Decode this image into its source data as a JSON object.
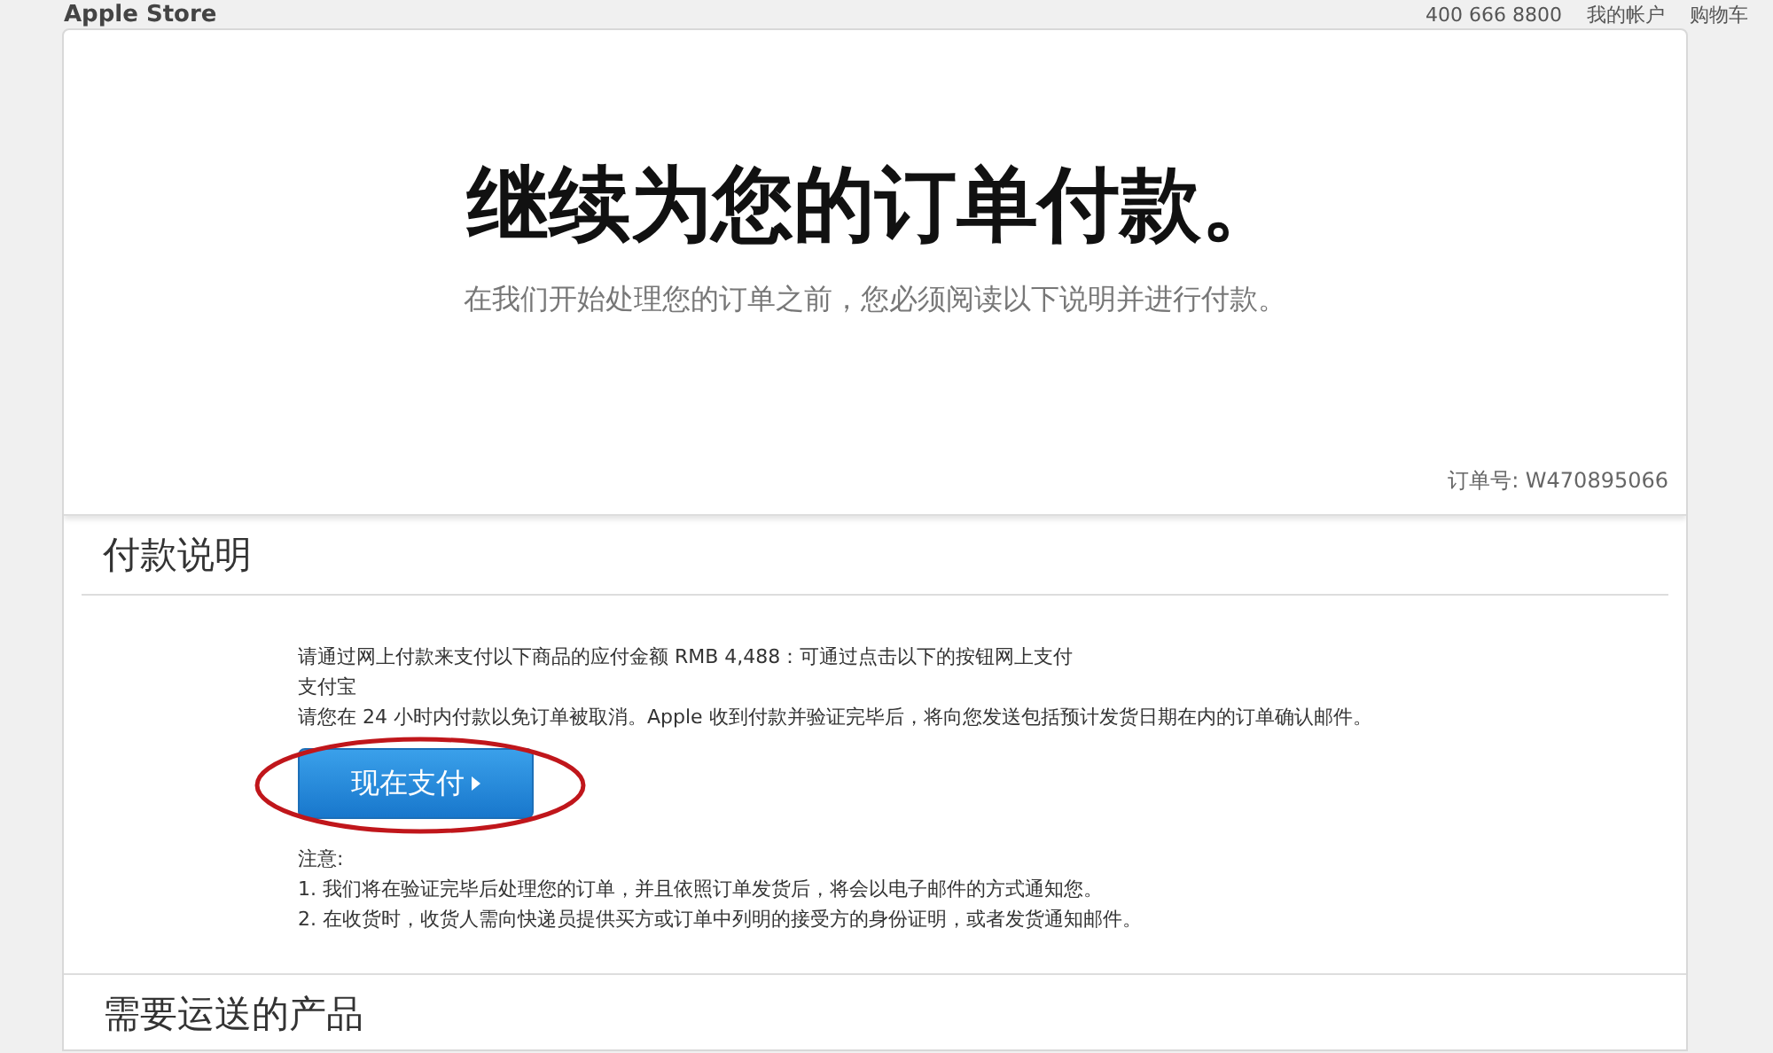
{
  "header": {
    "brand": "Apple Store",
    "phone": "400 666 8800",
    "account": "我的帐户",
    "cart": "购物车"
  },
  "hero": {
    "title": "继续为您的订单付款。",
    "subtitle": "在我们开始处理您的订单之前，您必须阅读以下说明并进行付款。",
    "order_number": "订单号: W470895066"
  },
  "payment": {
    "heading": "付款说明",
    "lines": [
      "请通过网上付款来支付以下商品的应付金额 RMB 4,488：可通过点击以下的按钮网上支付",
      "支付宝",
      "请您在 24 小时内付款以免订单被取消。Apple 收到付款并验证完毕后，将向您发送包括预计发货日期在内的订单确认邮件。"
    ],
    "pay_button": "现在支付",
    "notes_heading": "注意:",
    "notes": [
      "1. 我们将在验证完毕后处理您的订单，并且依照订单发货后，将会以电子邮件的方式通知您。",
      "2. 在收货时，收货人需向快递员提供买方或订单中列明的接受方的身份证明，或者发货通知邮件。"
    ]
  },
  "products": {
    "heading": "需要运送的产品"
  }
}
